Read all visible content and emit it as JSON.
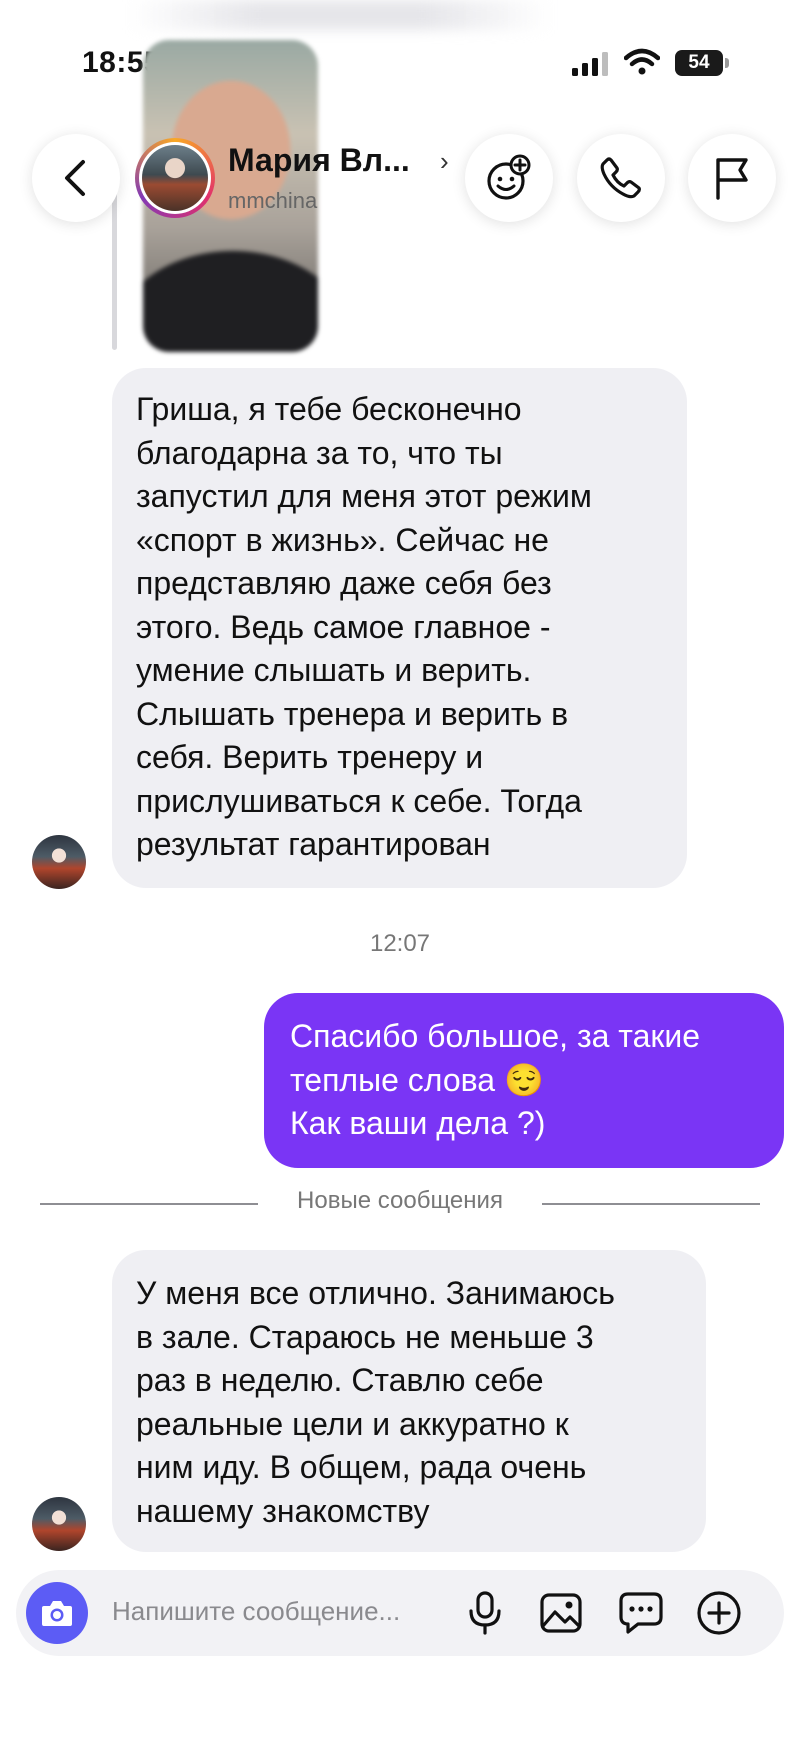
{
  "status_bar": {
    "time": "18:55",
    "battery": "54"
  },
  "header": {
    "contact_name": "Мария Вл...",
    "chevron": "›",
    "username": "mmchina"
  },
  "messages": {
    "first": {
      "lines": [
        "Гриша, я тебе бесконечно",
        "благодарна за то, что ты",
        "запустил для меня этот режим",
        "«спорт в жизнь». Сейчас не",
        "представляю даже себя без",
        "этого. Ведь самое главное -",
        "умение слышать и верить.",
        "Слышать тренера и верить в",
        "себя. Верить тренеру и",
        "прислушиваться к себе. Тогда",
        "результат гарантирован"
      ]
    },
    "timestamp": "12:07",
    "reply": {
      "lines": [
        "Спасибо большое, за такие",
        "теплые слова 😌",
        "Как ваши дела ?)"
      ]
    },
    "new_messages_label": "Новые сообщения",
    "last": {
      "lines": [
        "У меня все отлично. Занимаюсь",
        "в зале. Стараюсь не меньше 3",
        "раз в неделю. Ставлю себе",
        "реальные цели и аккуратно к",
        "ним иду. В общем, рада очень",
        "нашему знакомству"
      ]
    }
  },
  "composer": {
    "placeholder": "Напишите сообщение..."
  },
  "colors": {
    "accent": "#7a35f5",
    "camera_button": "#5c5cf5",
    "incoming_bubble": "#efeff3"
  },
  "icons": [
    "back-icon",
    "stickers-icon",
    "phone-icon",
    "flag-icon",
    "camera-icon",
    "mic-icon",
    "gallery-icon",
    "chat-icon",
    "plus-icon"
  ]
}
